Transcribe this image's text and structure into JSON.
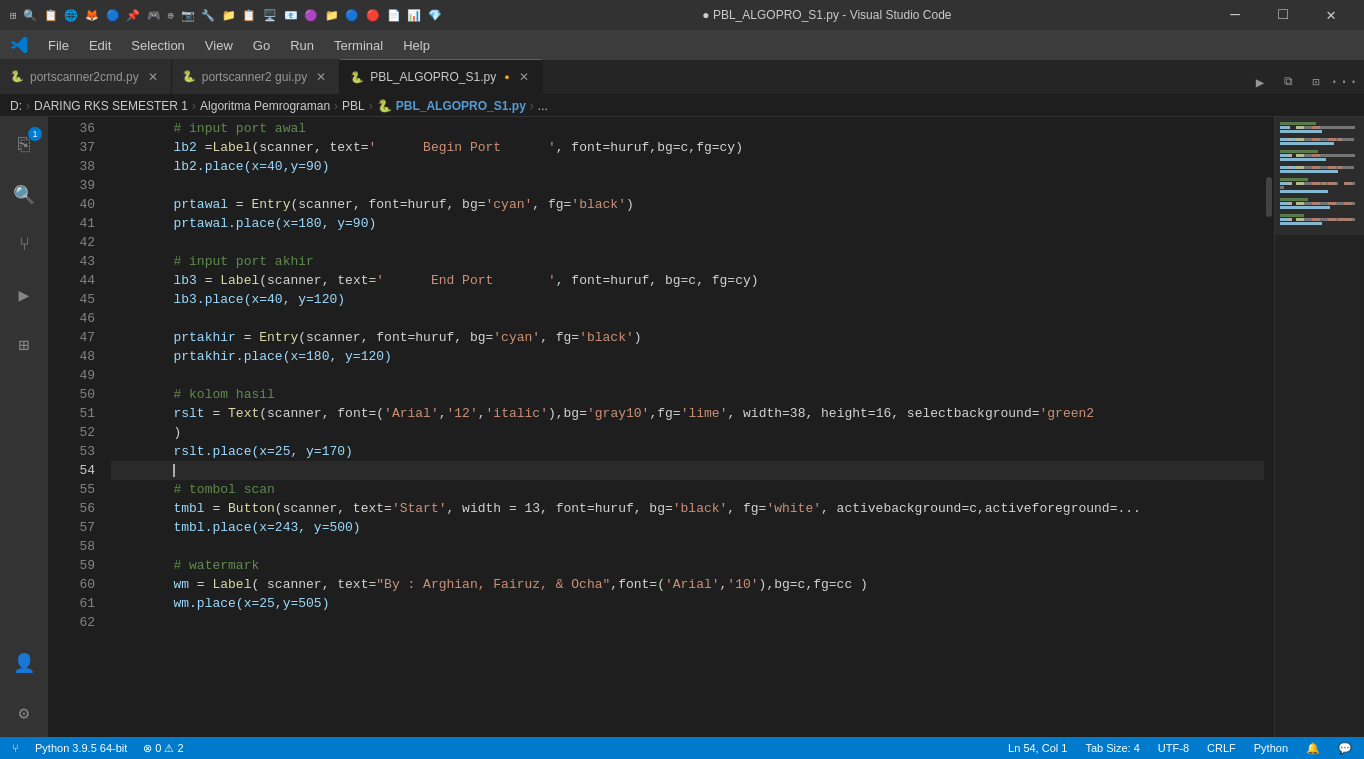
{
  "titlebar": {
    "title": "● PBL_ALGOPRO_S1.py - Visual Studio Code",
    "minimize_label": "—",
    "maximize_label": "□",
    "close_label": "✕"
  },
  "menubar": {
    "items": [
      "File",
      "Edit",
      "Selection",
      "View",
      "Go",
      "Run",
      "Terminal",
      "Help"
    ]
  },
  "tabs": [
    {
      "id": "tab1",
      "label": "portscanner2cmd.py",
      "icon": "🐍",
      "active": false,
      "modified": false
    },
    {
      "id": "tab2",
      "label": "portscanner2 gui.py",
      "icon": "🐍",
      "active": false,
      "modified": false
    },
    {
      "id": "tab3",
      "label": "PBL_ALGOPRO_S1.py",
      "icon": "🐍",
      "active": true,
      "modified": true
    }
  ],
  "breadcrumb": {
    "parts": [
      "D:",
      "DARING RKS SEMESTER 1",
      "Algoritma Pemrograman",
      "PBL",
      "PBL_ALGOPRO_S1.py",
      "..."
    ]
  },
  "activity": {
    "icons": [
      {
        "id": "explorer",
        "symbol": "⎘",
        "badge": "1",
        "active": false
      },
      {
        "id": "search",
        "symbol": "🔍",
        "active": false
      },
      {
        "id": "git",
        "symbol": "⑂",
        "active": false
      },
      {
        "id": "run",
        "symbol": "▶",
        "active": false
      },
      {
        "id": "extensions",
        "symbol": "⊞",
        "active": false
      },
      {
        "id": "account",
        "symbol": "👤",
        "active": false,
        "bottom": true
      },
      {
        "id": "settings",
        "symbol": "⚙",
        "active": false,
        "bottom": true
      }
    ]
  },
  "code": {
    "lines": [
      {
        "num": 36,
        "tokens": [
          {
            "text": "\t# input port awal",
            "class": "c-comment"
          }
        ]
      },
      {
        "num": 37,
        "tokens": [
          {
            "text": "\tlb2 ",
            "class": "c-var"
          },
          {
            "text": "=",
            "class": "c-equal"
          },
          {
            "text": "Label",
            "class": "c-function"
          },
          {
            "text": "(scanner, text=",
            "class": "c-punct"
          },
          {
            "text": "'      Begin Port      '",
            "class": "c-string"
          },
          {
            "text": ", font=huruf,bg=c,fg=cy)",
            "class": "c-punct"
          }
        ]
      },
      {
        "num": 38,
        "tokens": [
          {
            "text": "\tlb2.place(x=40,y=90)",
            "class": "c-var"
          }
        ]
      },
      {
        "num": 39,
        "tokens": [
          {
            "text": "",
            "class": ""
          }
        ]
      },
      {
        "num": 40,
        "tokens": [
          {
            "text": "\tprtawal ",
            "class": "c-var"
          },
          {
            "text": "= ",
            "class": "c-equal"
          },
          {
            "text": "Entry",
            "class": "c-function"
          },
          {
            "text": "(scanner, font=huruf, bg=",
            "class": "c-punct"
          },
          {
            "text": "'cyan'",
            "class": "c-string"
          },
          {
            "text": ", fg=",
            "class": "c-punct"
          },
          {
            "text": "'black'",
            "class": "c-string"
          },
          {
            "text": ")",
            "class": "c-punct"
          }
        ]
      },
      {
        "num": 41,
        "tokens": [
          {
            "text": "\tprtawal.place(x=180, y=90)",
            "class": "c-var"
          }
        ]
      },
      {
        "num": 42,
        "tokens": [
          {
            "text": "",
            "class": ""
          }
        ]
      },
      {
        "num": 43,
        "tokens": [
          {
            "text": "\t# input port akhir",
            "class": "c-comment"
          }
        ]
      },
      {
        "num": 44,
        "tokens": [
          {
            "text": "\tlb3 ",
            "class": "c-var"
          },
          {
            "text": "= ",
            "class": "c-equal"
          },
          {
            "text": "Label",
            "class": "c-function"
          },
          {
            "text": "(scanner, text=",
            "class": "c-punct"
          },
          {
            "text": "'      End Port       '",
            "class": "c-string"
          },
          {
            "text": ", font=huruf, bg=c, fg=cy)",
            "class": "c-punct"
          }
        ]
      },
      {
        "num": 45,
        "tokens": [
          {
            "text": "\tlb3.place(x=40, y=120)",
            "class": "c-var"
          }
        ]
      },
      {
        "num": 46,
        "tokens": [
          {
            "text": "",
            "class": ""
          }
        ]
      },
      {
        "num": 47,
        "tokens": [
          {
            "text": "\tprtakhir ",
            "class": "c-var"
          },
          {
            "text": "= ",
            "class": "c-equal"
          },
          {
            "text": "Entry",
            "class": "c-function"
          },
          {
            "text": "(scanner, font=huruf, bg=",
            "class": "c-punct"
          },
          {
            "text": "'cyan'",
            "class": "c-string"
          },
          {
            "text": ", fg=",
            "class": "c-punct"
          },
          {
            "text": "'black'",
            "class": "c-string"
          },
          {
            "text": ")",
            "class": "c-punct"
          }
        ]
      },
      {
        "num": 48,
        "tokens": [
          {
            "text": "\tprtakhir.place(x=180, y=120)",
            "class": "c-var"
          }
        ]
      },
      {
        "num": 49,
        "tokens": [
          {
            "text": "",
            "class": ""
          }
        ]
      },
      {
        "num": 50,
        "tokens": [
          {
            "text": "\t# kolom hasil",
            "class": "c-comment"
          }
        ]
      },
      {
        "num": 51,
        "tokens": [
          {
            "text": "\trslt ",
            "class": "c-var"
          },
          {
            "text": "= ",
            "class": "c-equal"
          },
          {
            "text": "Text",
            "class": "c-function"
          },
          {
            "text": "(scanner, font=(",
            "class": "c-punct"
          },
          {
            "text": "'Arial'",
            "class": "c-string"
          },
          {
            "text": ",",
            "class": "c-punct"
          },
          {
            "text": "'12'",
            "class": "c-string"
          },
          {
            "text": ",",
            "class": "c-punct"
          },
          {
            "text": "'italic'",
            "class": "c-string"
          },
          {
            "text": "),bg=",
            "class": "c-punct"
          },
          {
            "text": "'gray10'",
            "class": "c-string"
          },
          {
            "text": ",fg=",
            "class": "c-punct"
          },
          {
            "text": "'lime'",
            "class": "c-string"
          },
          {
            "text": ", width=38, height=16, selectbackground=",
            "class": "c-punct"
          },
          {
            "text": "'green2",
            "class": "c-string"
          }
        ]
      },
      {
        "num": 52,
        "tokens": [
          {
            "text": "\t)",
            "class": "c-punct"
          }
        ]
      },
      {
        "num": 53,
        "tokens": [
          {
            "text": "\trslt.place(x=25, y=170)",
            "class": "c-var"
          }
        ]
      },
      {
        "num": 54,
        "tokens": [
          {
            "text": "\t",
            "class": ""
          }
        ],
        "active": true
      },
      {
        "num": 55,
        "tokens": [
          {
            "text": "\t# tombol scan",
            "class": "c-comment"
          }
        ]
      },
      {
        "num": 56,
        "tokens": [
          {
            "text": "\ttmbl ",
            "class": "c-var"
          },
          {
            "text": "= ",
            "class": "c-equal"
          },
          {
            "text": "Button",
            "class": "c-function"
          },
          {
            "text": "(scanner, text=",
            "class": "c-punct"
          },
          {
            "text": "'Start'",
            "class": "c-string"
          },
          {
            "text": ", width = 13, font=huruf, bg=",
            "class": "c-punct"
          },
          {
            "text": "'black'",
            "class": "c-string"
          },
          {
            "text": ", fg=",
            "class": "c-punct"
          },
          {
            "text": "'white'",
            "class": "c-string"
          },
          {
            "text": ", activebackground=c,activeforeground=...",
            "class": "c-punct"
          }
        ]
      },
      {
        "num": 57,
        "tokens": [
          {
            "text": "\ttmbl.place(x=243, y=500)",
            "class": "c-var"
          }
        ]
      },
      {
        "num": 58,
        "tokens": [
          {
            "text": "",
            "class": ""
          }
        ]
      },
      {
        "num": 59,
        "tokens": [
          {
            "text": "\t# watermark",
            "class": "c-comment"
          }
        ]
      },
      {
        "num": 60,
        "tokens": [
          {
            "text": "\twm ",
            "class": "c-var"
          },
          {
            "text": "= ",
            "class": "c-equal"
          },
          {
            "text": "Label",
            "class": "c-function"
          },
          {
            "text": "( scanner, text=",
            "class": "c-punct"
          },
          {
            "text": "\"By : Arghian, Fairuz, & Ocha\"",
            "class": "c-string"
          },
          {
            "text": ",font=(",
            "class": "c-punct"
          },
          {
            "text": "'Arial'",
            "class": "c-string"
          },
          {
            "text": ",",
            "class": "c-punct"
          },
          {
            "text": "'10'",
            "class": "c-string"
          },
          {
            "text": "),bg=c,fg=cc )",
            "class": "c-punct"
          }
        ]
      },
      {
        "num": 61,
        "tokens": [
          {
            "text": "\twm.place(x=25,y=505)",
            "class": "c-var"
          }
        ]
      },
      {
        "num": 62,
        "tokens": [
          {
            "text": "",
            "class": ""
          }
        ]
      }
    ]
  },
  "statusbar": {
    "python_version": "Python 3.9.5 64-bit",
    "errors_icon": "⊗",
    "errors": "0",
    "warnings_icon": "⚠",
    "warnings": "2",
    "ln": "Ln 54, Col 1",
    "tab_size": "Tab Size: 4",
    "encoding": "UTF-8",
    "line_ending": "CRLF",
    "language": "Python",
    "notifications_icon": "🔔",
    "feedback_icon": "💬"
  }
}
